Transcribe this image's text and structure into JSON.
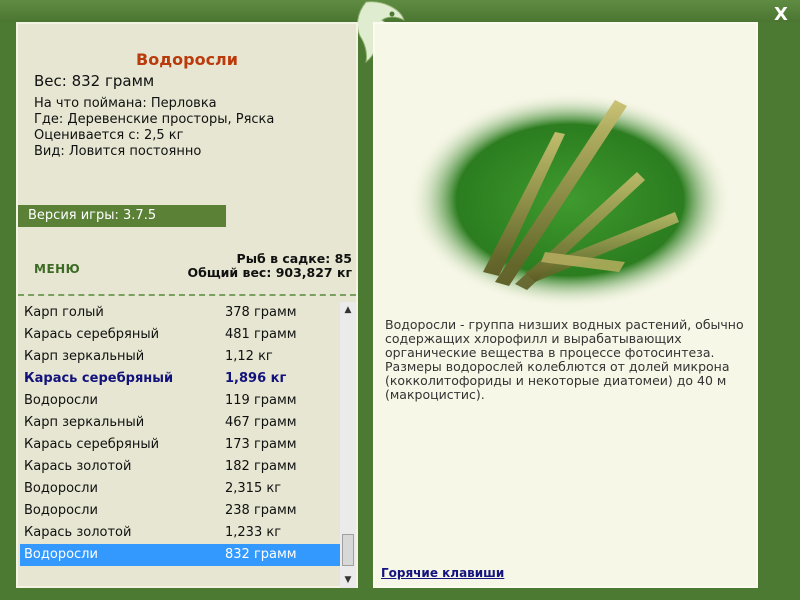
{
  "window": {
    "close_label": "X"
  },
  "item": {
    "title": "Водоросли",
    "weight": "Вес: 832 грамм",
    "bait": "На что поймана: Перловка",
    "location": "Где: Деревенские просторы, Ряска",
    "valued_from": "Оценивается с: 2,5 кг",
    "kind": "Вид: Ловится постоянно"
  },
  "version": "Версия игры: 3.7.5",
  "menu_label": "МЕНЮ",
  "stats": {
    "fish_in_cage": "Рыб в садке: 85",
    "total_weight": "Общий вес: 903,827 кг"
  },
  "catch_list": [
    {
      "name": "Карп голый",
      "weight": "378 грамм"
    },
    {
      "name": "Карась серебряный",
      "weight": "481 грамм"
    },
    {
      "name": "Карп зеркальный",
      "weight": "1,12 кг"
    },
    {
      "name": "Карась серебряный",
      "weight": "1,896 кг"
    },
    {
      "name": "Водоросли",
      "weight": "119 грамм"
    },
    {
      "name": "Карп зеркальный",
      "weight": "467 грамм"
    },
    {
      "name": "Карась серебряный",
      "weight": "173 грамм"
    },
    {
      "name": "Карась золотой",
      "weight": "182 грамм"
    },
    {
      "name": "Водоросли",
      "weight": "2,315 кг"
    },
    {
      "name": "Водоросли",
      "weight": "238 грамм"
    },
    {
      "name": "Карась золотой",
      "weight": "1,233 кг"
    },
    {
      "name": "Водоросли",
      "weight": "832 грамм"
    }
  ],
  "description": "Водоросли - группа низших водных растений, обычно содержащих хлорофилл и вырабатывающих органические вещества в процессе фотосинтеза. Размеры водорослей колеблются от долей микрона (кокколитофориды и некоторые диатомеи) до 40 м (макроцистис).",
  "hotkeys_label": "Горячие клавиши",
  "colors": {
    "frame": "#4d7a33",
    "title": "#bb3a0c",
    "highlight_text": "#12127c",
    "selected_row": "#3399ff"
  }
}
